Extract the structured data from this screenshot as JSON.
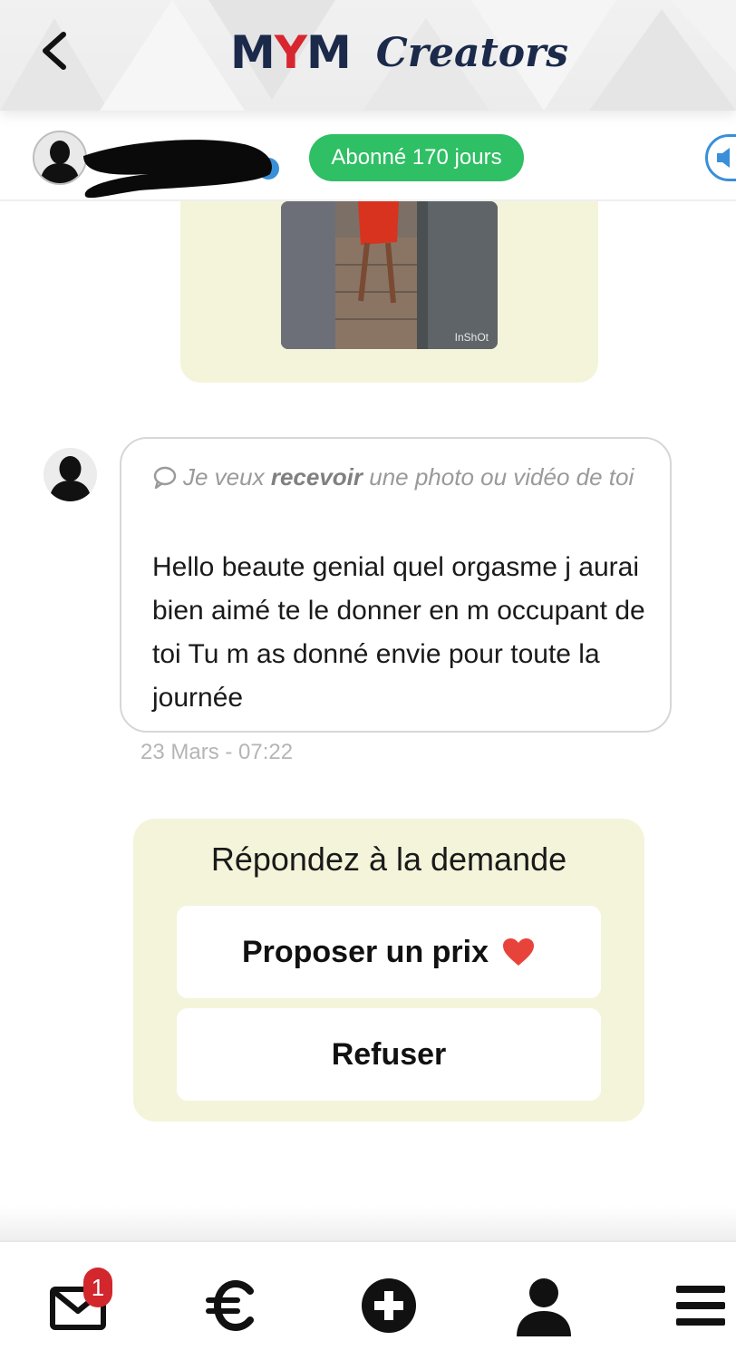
{
  "header": {
    "logo_mym_m1": "M",
    "logo_mym_y": "Y",
    "logo_mym_m2": "M",
    "logo_creators": "Creators"
  },
  "userbar": {
    "subscription_badge": "Abonné 170 jours"
  },
  "media": {
    "watermark": "InShOt"
  },
  "message": {
    "request_prefix": "Je veux ",
    "request_bold": "recevoir",
    "request_suffix": " une photo ou vidéo de toi",
    "text": "Hello beaute genial quel orgasme j aurai bien aimé te le donner en m occupant de toi Tu m as donné envie pour toute la journée",
    "timestamp": "23 Mars - 07:22"
  },
  "response": {
    "title": "Répondez à la demande",
    "propose_label": "Proposer un prix",
    "refuse_label": "Refuser"
  },
  "bottom_nav": {
    "messages_badge": "1",
    "icons": [
      "envelope-icon",
      "euro-icon",
      "plus-circle-icon",
      "user-icon",
      "menu-icon"
    ]
  },
  "colors": {
    "brand_navy": "#1b2a4a",
    "brand_red": "#d7262f",
    "badge_green": "#2fbf64",
    "card_cream": "#f4f4da",
    "heart_red": "#e8433b",
    "notif_red": "#d2272d"
  }
}
